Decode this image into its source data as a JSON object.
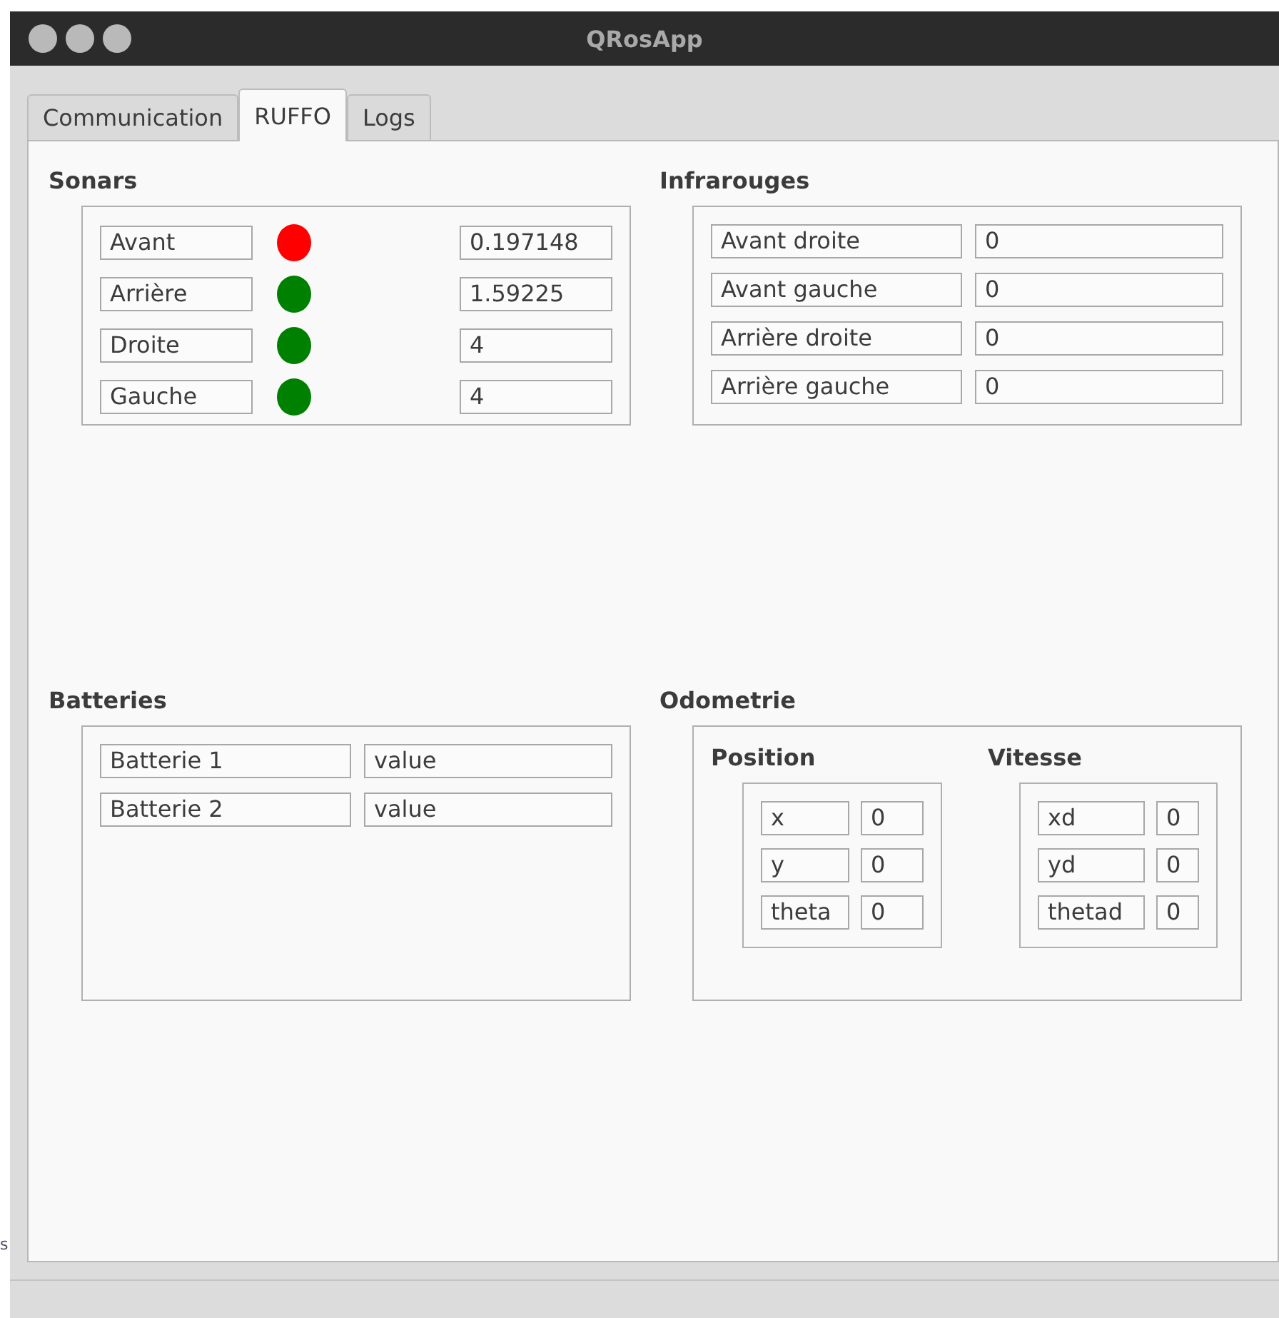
{
  "margin_text": "s",
  "window": {
    "title": "QRosApp"
  },
  "tabs": [
    {
      "label": "Communication",
      "selected": false
    },
    {
      "label": "RUFFO",
      "selected": true
    },
    {
      "label": "Logs",
      "selected": false
    }
  ],
  "sonars": {
    "title": "Sonars",
    "rows": [
      {
        "label": "Avant",
        "color": "#ff0000",
        "value": "0.197148"
      },
      {
        "label": "Arrière",
        "color": "#008000",
        "value": "1.59225"
      },
      {
        "label": "Droite",
        "color": "#008000",
        "value": "4"
      },
      {
        "label": "Gauche",
        "color": "#008000",
        "value": "4"
      }
    ]
  },
  "infrarouges": {
    "title": "Infrarouges",
    "rows": [
      {
        "label": "Avant droite",
        "value": "0"
      },
      {
        "label": "Avant gauche",
        "value": "0"
      },
      {
        "label": "Arrière droite",
        "value": "0"
      },
      {
        "label": "Arrière gauche",
        "value": "0"
      }
    ]
  },
  "batteries": {
    "title": "Batteries",
    "rows": [
      {
        "label": "Batterie 1",
        "value": "value"
      },
      {
        "label": "Batterie 2",
        "value": "value"
      }
    ]
  },
  "odometrie": {
    "title": "Odometrie",
    "groups": [
      {
        "title": "Position",
        "rows": [
          {
            "label": "x",
            "value": "0"
          },
          {
            "label": "y",
            "value": "0"
          },
          {
            "label": "theta",
            "value": "0"
          }
        ]
      },
      {
        "title": "Vitesse",
        "rows": [
          {
            "label": "xd",
            "value": "0"
          },
          {
            "label": "yd",
            "value": "0"
          },
          {
            "label": "thetad",
            "value": "0"
          }
        ]
      }
    ]
  }
}
